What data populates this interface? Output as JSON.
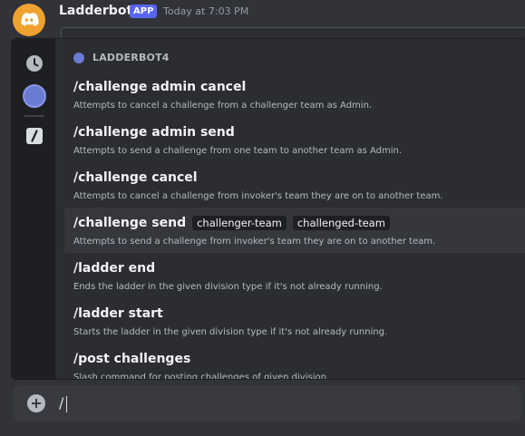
{
  "message": {
    "username": "Ladderbot4",
    "app_tag": "APP",
    "timestamp": "Today at 7:03 PM"
  },
  "popup": {
    "section_title": "LADDERBOT4",
    "commands": [
      {
        "name": "/challenge admin cancel",
        "options": [],
        "description": "Attempts to cancel a challenge from a challenger team as Admin."
      },
      {
        "name": "/challenge admin send",
        "options": [],
        "description": "Attempts to send a challenge from one team to another team as Admin."
      },
      {
        "name": "/challenge cancel",
        "options": [],
        "description": "Attempts to cancel a challenge from invoker's team they are on to another team."
      },
      {
        "name": "/challenge send",
        "options": [
          "challenger-team",
          "challenged-team"
        ],
        "description": "Attempts to send a challenge from invoker's team they are on to another team."
      },
      {
        "name": "/ladder end",
        "options": [],
        "description": "Ends the ladder in the given division type if it's not already running."
      },
      {
        "name": "/ladder start",
        "options": [],
        "description": "Starts the ladder in the given division type if it's not already running."
      },
      {
        "name": "/post challenges",
        "options": [],
        "description": "Slash command for posting challenges of given division."
      }
    ],
    "rail_icons": [
      "clock-icon",
      "bot-avatar",
      "slash-command-icon"
    ]
  },
  "chat": {
    "input_value": "/"
  },
  "colors": {
    "background": "#313338",
    "popup_bg": "#2b2d31",
    "rail_bg": "#1e1f22",
    "active_row": "#35373c",
    "accent": "#5865f2",
    "avatar": "#f0a231"
  }
}
